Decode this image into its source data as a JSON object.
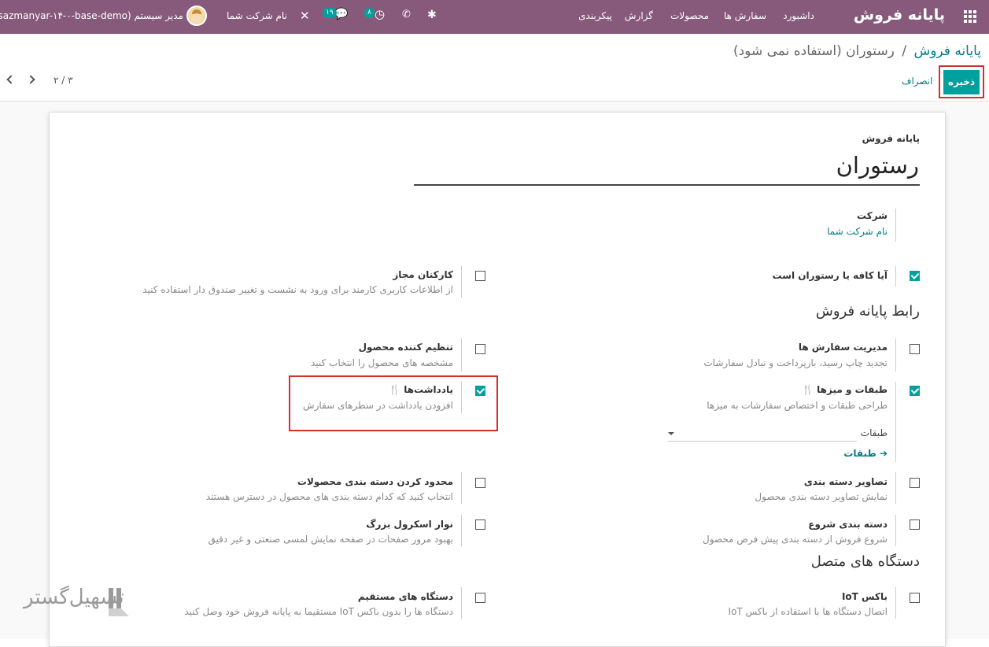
{
  "topbar": {
    "brand": "پایانه فروش",
    "menu": [
      "داشبورد",
      "سفارش ها",
      "محصولات",
      "گزارش",
      "پیکربندی"
    ],
    "activity_count": "۸",
    "messages_count": "۱۹",
    "company_name": "نام شرکت شما",
    "user_label": "مدیر سیستم (sazmanyar-۱۴-۰-base-demo)"
  },
  "breadcrumb": {
    "parent": "پایانه فروش",
    "separator": "/",
    "current": "رستوران (استفاده نمی شود)"
  },
  "toolbar": {
    "save_label": "ذخیره",
    "cancel_label": "انصراف",
    "pager": "۲ / ۳"
  },
  "form": {
    "pos_label": "پایانه فروش",
    "name": "رستوران",
    "company_label": "شرکت",
    "company_value": "نام شرکت شما",
    "is_restaurant": {
      "title": "آیا کافه یا رستوران است",
      "checked": true
    },
    "authorized_employees": {
      "title": "کارکنان مجاز",
      "desc": "از اطلاعات کاربری کارمند برای ورود به نشست و تغییر صندوق دار استفاده کنید",
      "checked": false
    },
    "section_interface": "رابط پایانه فروش",
    "order_management": {
      "title": "مدیریت سفارش ها",
      "desc": "تجدید چاپ رسید، بازپرداخت و تبادل سفارشات",
      "checked": false
    },
    "product_configurator": {
      "title": "تنظیم کننده محصول",
      "desc": "مشخصه های محصول را انتخاب کنید",
      "checked": false
    },
    "floors_tables": {
      "title": "طبقات و میزها",
      "desc": "طراحی طبقات و اختصاص سفارشات به میزها",
      "checked": true,
      "field_label": "طبقات",
      "link_label": "طبقات"
    },
    "notes": {
      "title": "یادداشت‌ها",
      "desc": "افزودن یادداشت در سطرهای سفارش",
      "checked": true
    },
    "category_images": {
      "title": "تصاویر دسته بندی",
      "desc": "نمایش تصاویر دسته بندی محصول",
      "checked": false
    },
    "limit_categories": {
      "title": "محدود کردن دسته بندی محصولات",
      "desc": "انتخاب کنید که کدام دسته بندی های محصول در دسترس هستند",
      "checked": false
    },
    "start_category": {
      "title": "دسته بندی شروع",
      "desc": "شروع فروش از دسته بندی پیش فرض محصول",
      "checked": false
    },
    "large_scrollbar": {
      "title": "نوار اسکرول بزرگ",
      "desc": "بهبود مرور صفحات در صفحه نمایش لمسی صنعتی و غیر دقیق",
      "checked": false
    },
    "section_devices": "دستگاه های متصل",
    "iot_box": {
      "title": "باکس IoT",
      "desc": "اتصال دستگاه ها با استفاده از باکس IoT",
      "checked": false
    },
    "direct_devices": {
      "title": "دستگاه های مستقیم",
      "desc": "دستگاه ها را بدون باکس IoT مستقیما به پایانه فروش خود وصل کنید",
      "checked": false
    }
  },
  "watermark": "تسهیل‌گستر",
  "colors": {
    "brand": "#875a7b",
    "accent": "#00a09d",
    "link": "#017e84",
    "highlight": "#d32f2f"
  }
}
